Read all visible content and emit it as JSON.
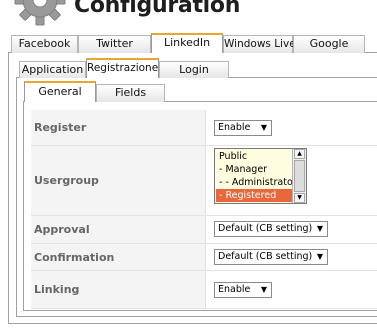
{
  "page": {
    "title": "Configuration",
    "icon": "gear-icon"
  },
  "provider_tabs": [
    {
      "label": "Facebook",
      "active": false
    },
    {
      "label": "Twitter",
      "active": false
    },
    {
      "label": "LinkedIn",
      "active": true
    },
    {
      "label": "Windows Live",
      "active": false
    },
    {
      "label": "Google",
      "active": false
    }
  ],
  "section_tabs": [
    {
      "label": "Application",
      "active": false
    },
    {
      "label": "Registrazione",
      "active": true
    },
    {
      "label": "Login",
      "active": false
    }
  ],
  "sub_tabs": [
    {
      "label": "General",
      "active": true
    },
    {
      "label": "Fields",
      "active": false
    }
  ],
  "settings": {
    "register": {
      "label": "Register",
      "value": "Enable"
    },
    "usergroup": {
      "label": "Usergroup",
      "options": [
        "Public",
        "- Manager",
        "- - Administrator",
        "- Registered"
      ],
      "selected": "- Registered"
    },
    "approval": {
      "label": "Approval",
      "value": "Default (CB setting)"
    },
    "confirmation": {
      "label": "Confirmation",
      "value": "Default (CB setting)"
    },
    "linking": {
      "label": "Linking",
      "value": "Enable"
    }
  },
  "icons": {
    "dropdown": "triangle-down-icon",
    "scroll_up": "triangle-up-icon",
    "scroll_down": "triangle-down-icon"
  },
  "colors": {
    "active_tab_accent": "#e8a630",
    "selected_option": "#e8673b",
    "listbox_background": "#fffde0"
  }
}
